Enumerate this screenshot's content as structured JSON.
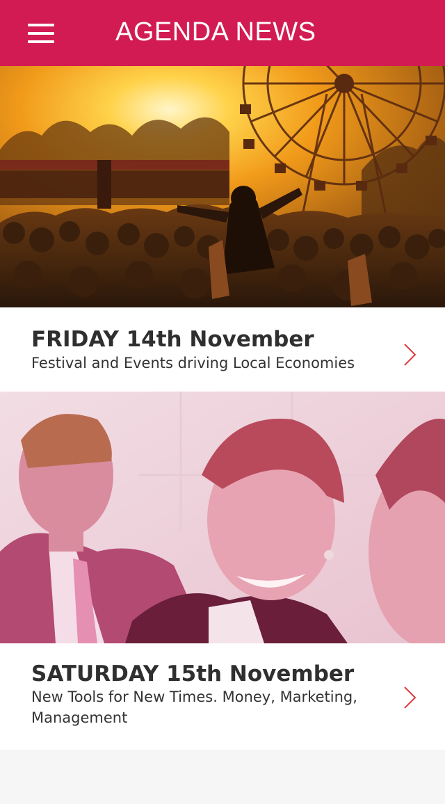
{
  "header": {
    "title": "AGENDA NEWS",
    "menu_icon": "hamburger-menu-icon",
    "background_color": "#d21b52"
  },
  "cards": [
    {
      "date": "FRIDAY 14th November",
      "description": "Festival and Events driving Local Economies",
      "image": "festival-crowd-ferris-wheel-photo",
      "action_icon": "chevron-right-icon"
    },
    {
      "date": "SATURDAY 15th November",
      "description": "New Tools for New Times. Money, Marketing, Management",
      "image": "business-people-photo",
      "action_icon": "chevron-right-icon"
    }
  ],
  "colors": {
    "accent": "#d21b52",
    "chevron": "#e23a3a",
    "text": "#2f2f2f"
  }
}
